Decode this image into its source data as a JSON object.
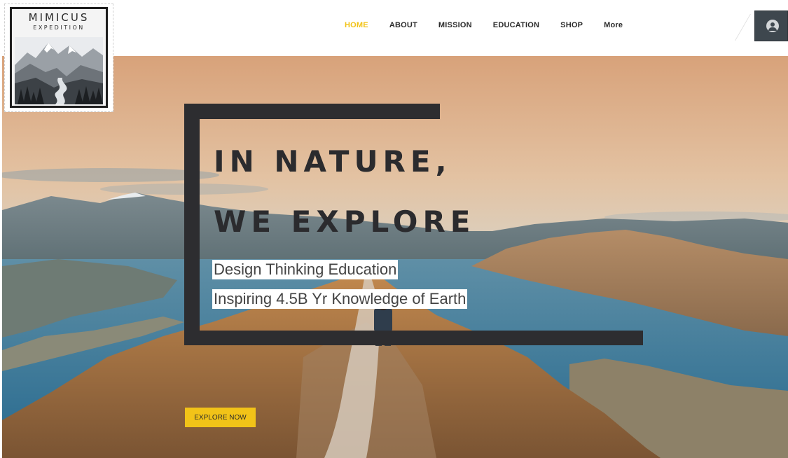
{
  "brand": {
    "name_line1": "MIMICUS",
    "name_line2": "EXPEDITION"
  },
  "nav": {
    "items": [
      {
        "label": "HOME",
        "active": true
      },
      {
        "label": "ABOUT",
        "active": false
      },
      {
        "label": "MISSION",
        "active": false
      },
      {
        "label": "EDUCATION",
        "active": false
      },
      {
        "label": "SHOP",
        "active": false
      },
      {
        "label": "More",
        "active": false
      }
    ],
    "member_icon": "user-account-icon"
  },
  "hero": {
    "headline_line1": "IN NATURE,",
    "headline_line2": "WE EXPLORE",
    "subline1": "Design Thinking Education",
    "subline2": "Inspiring 4.5B Yr Knowledge of Earth",
    "cta_label": "EXPLORE NOW"
  },
  "colors": {
    "accent": "#f2c318",
    "frame": "#2d2d30",
    "text_dark": "#2b2b2e"
  }
}
